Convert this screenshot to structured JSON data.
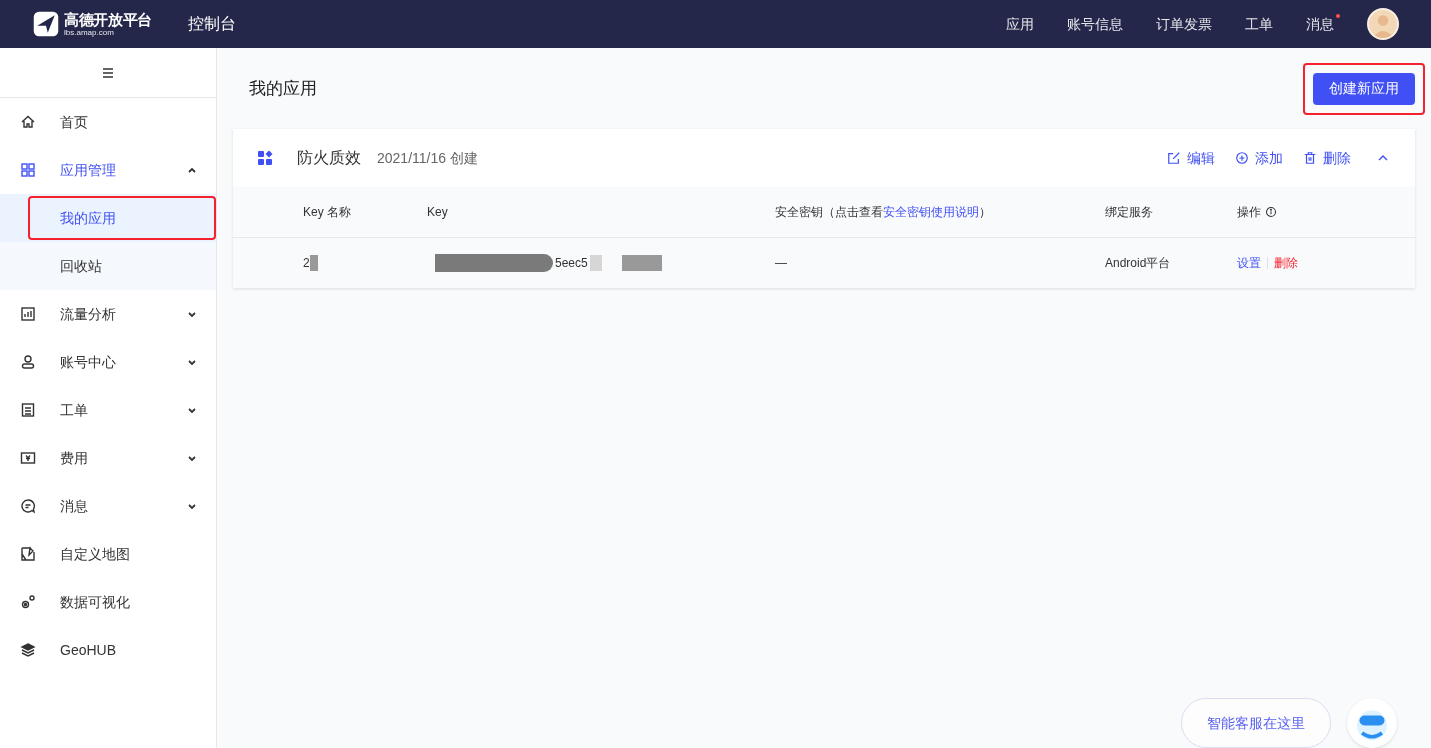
{
  "top_bar": {
    "logo": {
      "name": "高德开放平台",
      "url": "lbs.amap.com"
    },
    "title": "控制台",
    "nav": [
      {
        "label": "应用",
        "dot": false
      },
      {
        "label": "账号信息",
        "dot": false
      },
      {
        "label": "订单发票",
        "dot": false
      },
      {
        "label": "工单",
        "dot": false
      },
      {
        "label": "消息",
        "dot": true
      }
    ]
  },
  "sidebar": {
    "items": [
      {
        "kind": "home",
        "label": "首页",
        "selected": false
      },
      {
        "kind": "grid",
        "label": "应用管理",
        "selected": true,
        "expanded": true,
        "children": [
          {
            "label": "我的应用",
            "selected": true,
            "highlighted": true
          },
          {
            "label": "回收站",
            "selected": false,
            "highlighted": false
          }
        ]
      },
      {
        "kind": "chart",
        "label": "流量分析",
        "selected": false,
        "expanded": false
      },
      {
        "kind": "user",
        "label": "账号中心",
        "selected": false,
        "expanded": false
      },
      {
        "kind": "ticket",
        "label": "工单",
        "selected": false,
        "expanded": false
      },
      {
        "kind": "money",
        "label": "费用",
        "selected": false,
        "expanded": false
      },
      {
        "kind": "message",
        "label": "消息",
        "selected": false,
        "expanded": false
      },
      {
        "kind": "map",
        "label": "自定义地图",
        "selected": false
      },
      {
        "kind": "dots",
        "label": "数据可视化",
        "selected": false
      },
      {
        "kind": "layers",
        "label": "GeoHUB",
        "selected": false
      }
    ]
  },
  "page": {
    "title": "我的应用",
    "create_button": {
      "label": "创建新应用",
      "highlighted": true
    }
  },
  "app_card": {
    "name": "防火质效",
    "created": "2021/11/16 创建",
    "actions": [
      {
        "kind": "edit",
        "label": "编辑"
      },
      {
        "kind": "add",
        "label": "添加"
      },
      {
        "kind": "delete",
        "label": "删除"
      }
    ],
    "expanded": true,
    "table": {
      "columns": [
        {
          "label": "Key 名称"
        },
        {
          "label": "Key"
        },
        {
          "label": "安全密钥（点击查看",
          "link": "安全密钥使用说明",
          "suffix": "）"
        },
        {
          "label": "绑定服务"
        },
        {
          "label": "操作",
          "info": true
        }
      ],
      "rows": [
        {
          "key_name": "2",
          "key": "5eec5",
          "secret": "—",
          "service": "Android平台",
          "ops": [
            {
              "label": "设置",
              "danger": false
            },
            {
              "label": "删除",
              "danger": true
            }
          ]
        }
      ]
    }
  },
  "assistant": {
    "label": "智能客服在这里"
  }
}
